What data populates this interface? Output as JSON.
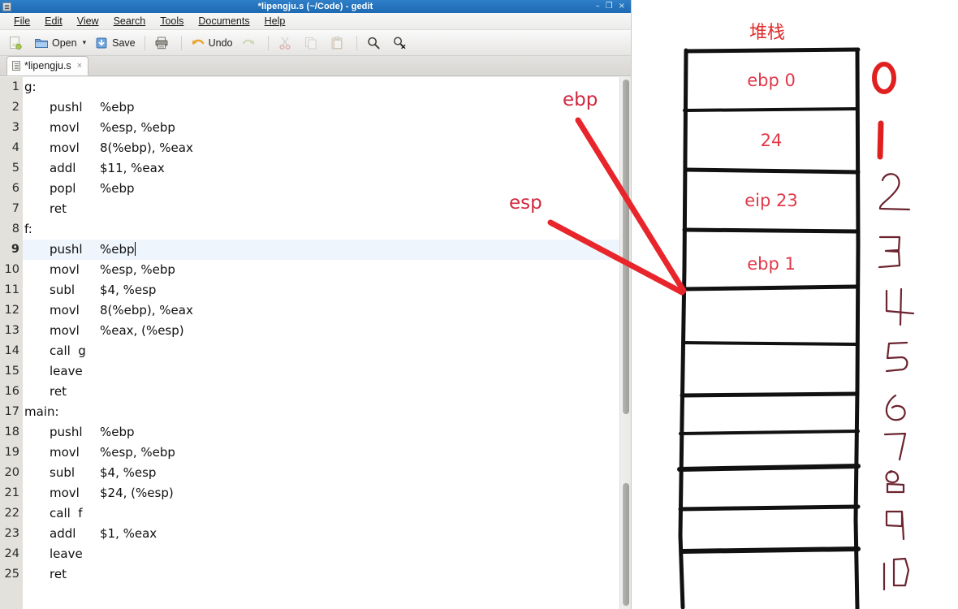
{
  "window": {
    "title": "*lipengju.s (~/Code) - gedit",
    "app_icon": "document-icon",
    "controls": {
      "minimize": "–",
      "maximize": "❐",
      "close": "×"
    }
  },
  "menubar": {
    "items": [
      {
        "label": "File"
      },
      {
        "label": "Edit"
      },
      {
        "label": "View"
      },
      {
        "label": "Search"
      },
      {
        "label": "Tools"
      },
      {
        "label": "Documents"
      },
      {
        "label": "Help"
      }
    ]
  },
  "toolbar": {
    "new_label": "",
    "open_label": "Open",
    "open_caret": "▾",
    "save_label": "Save",
    "print_label": "",
    "undo_label": "Undo",
    "redo_label": "",
    "cut_label": "",
    "copy_label": "",
    "paste_label": "",
    "find_label": "",
    "replace_label": ""
  },
  "tab": {
    "label": "*lipengju.s",
    "close": "×",
    "icon": "document-icon"
  },
  "editor": {
    "current_line": 9,
    "lines": [
      {
        "n": "1",
        "indent": false,
        "mn": "g:",
        "op": ""
      },
      {
        "n": "2",
        "indent": true,
        "mn": "pushl",
        "op": "%ebp"
      },
      {
        "n": "3",
        "indent": true,
        "mn": "movl",
        "op": "%esp, %ebp"
      },
      {
        "n": "4",
        "indent": true,
        "mn": "movl",
        "op": "8(%ebp), %eax"
      },
      {
        "n": "5",
        "indent": true,
        "mn": "addl",
        "op": "$11, %eax"
      },
      {
        "n": "6",
        "indent": true,
        "mn": "popl",
        "op": "%ebp"
      },
      {
        "n": "7",
        "indent": true,
        "mn": "ret",
        "op": ""
      },
      {
        "n": "8",
        "indent": false,
        "mn": "f:",
        "op": ""
      },
      {
        "n": "9",
        "indent": true,
        "mn": "pushl",
        "op": "%ebp"
      },
      {
        "n": "10",
        "indent": true,
        "mn": "movl",
        "op": "%esp, %ebp"
      },
      {
        "n": "11",
        "indent": true,
        "mn": "subl",
        "op": "$4, %esp"
      },
      {
        "n": "12",
        "indent": true,
        "mn": "movl",
        "op": "8(%ebp), %eax"
      },
      {
        "n": "13",
        "indent": true,
        "mn": "movl",
        "op": "%eax, (%esp)"
      },
      {
        "n": "14",
        "indent": true,
        "mn": "call  g",
        "op": ""
      },
      {
        "n": "15",
        "indent": true,
        "mn": "leave",
        "op": ""
      },
      {
        "n": "16",
        "indent": true,
        "mn": "ret",
        "op": ""
      },
      {
        "n": "17",
        "indent": false,
        "mn": "main:",
        "op": ""
      },
      {
        "n": "18",
        "indent": true,
        "mn": "pushl",
        "op": "%ebp"
      },
      {
        "n": "19",
        "indent": true,
        "mn": "movl",
        "op": "%esp, %ebp"
      },
      {
        "n": "20",
        "indent": true,
        "mn": "subl",
        "op": "$4, %esp"
      },
      {
        "n": "21",
        "indent": true,
        "mn": "movl",
        "op": "$24, (%esp)"
      },
      {
        "n": "22",
        "indent": true,
        "mn": "call  f",
        "op": ""
      },
      {
        "n": "23",
        "indent": true,
        "mn": "addl",
        "op": "$1, %eax"
      },
      {
        "n": "24",
        "indent": true,
        "mn": "leave",
        "op": ""
      },
      {
        "n": "25",
        "indent": true,
        "mn": "ret",
        "op": ""
      }
    ]
  },
  "diagram": {
    "title": "堆栈",
    "accent_red": "#e0394a",
    "arrow_red": "#e8252b",
    "cells": [
      {
        "label": "ebp 0"
      },
      {
        "label": "24"
      },
      {
        "label": "eip 23"
      },
      {
        "label": "ebp 1"
      },
      {
        "label": ""
      },
      {
        "label": ""
      },
      {
        "label": ""
      },
      {
        "label": ""
      },
      {
        "label": ""
      },
      {
        "label": ""
      },
      {
        "label": ""
      }
    ],
    "row_numbers": [
      "0",
      "1",
      "2",
      "3",
      "4",
      "5",
      "6",
      "7",
      "8",
      "9",
      "10"
    ],
    "pointers": [
      {
        "name": "ebp",
        "label": "ebp"
      },
      {
        "name": "esp",
        "label": "esp"
      }
    ]
  }
}
